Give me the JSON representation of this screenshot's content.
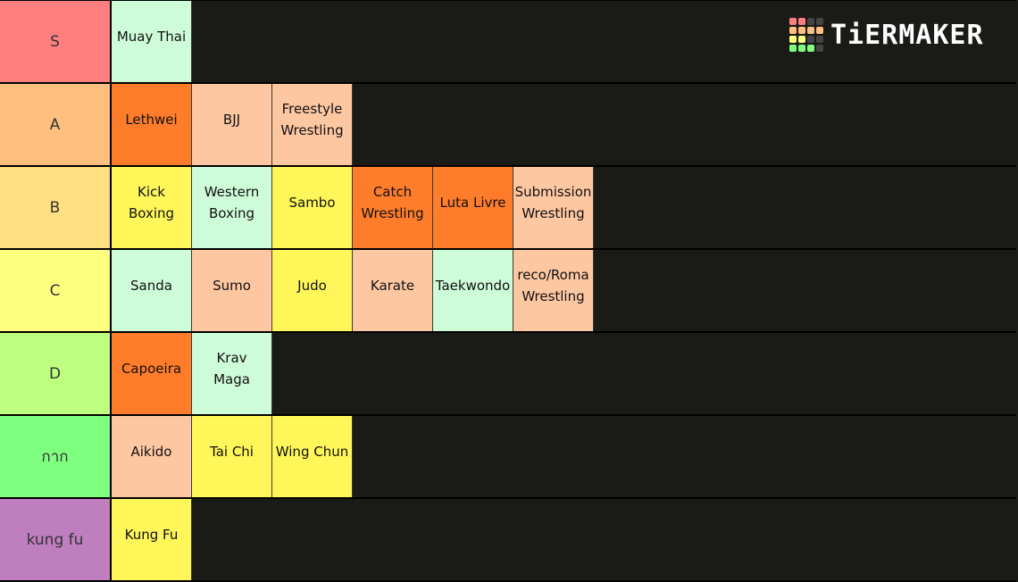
{
  "logo": {
    "text": "TiERMAKER",
    "grid_colors": [
      "#ff7f7f",
      "#ff7f7f",
      "#444444",
      "#444444",
      "#ffbf7f",
      "#ffbf7f",
      "#ffbf7f",
      "#ffbf7f",
      "#ffff7f",
      "#ffff7f",
      "#444444",
      "#444444",
      "#7fff7f",
      "#7fff7f",
      "#7fff7f",
      "#444444"
    ]
  },
  "tiers": [
    {
      "label": "S",
      "color": "#ff7f7f",
      "items": [
        {
          "name": "Muay Thai",
          "color": "#cffcd8"
        }
      ]
    },
    {
      "label": "A",
      "color": "#ffbf7f",
      "items": [
        {
          "name": "Lethwei",
          "color": "#fe7c2a"
        },
        {
          "name": "BJJ",
          "color": "#fdc7a2"
        },
        {
          "name": "Freestyle\nWrestling",
          "color": "#fdc7a2"
        }
      ]
    },
    {
      "label": "B",
      "color": "#ffdf7f",
      "items": [
        {
          "name": "Kick\nBoxing",
          "color": "#fff75a"
        },
        {
          "name": "Western\nBoxing",
          "color": "#cffcd8"
        },
        {
          "name": "Sambo",
          "color": "#fff75a"
        },
        {
          "name": "Catch\nWrestling",
          "color": "#fe7c2a"
        },
        {
          "name": "Luta Livre",
          "color": "#fe7c2a"
        },
        {
          "name": "Submission\nWrestling",
          "color": "#fdc7a2"
        }
      ]
    },
    {
      "label": "C",
      "color": "#ffff7f",
      "items": [
        {
          "name": "Sanda",
          "color": "#cffcd8"
        },
        {
          "name": "Sumo",
          "color": "#fdc7a2"
        },
        {
          "name": "Judo",
          "color": "#fff75a"
        },
        {
          "name": "Karate",
          "color": "#fdc7a2"
        },
        {
          "name": "Taekwondo",
          "color": "#cffcd8"
        },
        {
          "name": "reco/Roma\nWrestling",
          "color": "#fdc7a2"
        }
      ]
    },
    {
      "label": "D",
      "color": "#bfff7f",
      "items": [
        {
          "name": "Capoeira",
          "color": "#fe7c2a"
        },
        {
          "name": "Krav\nMaga",
          "color": "#cffcd8"
        }
      ]
    },
    {
      "label": "กาก",
      "color": "#7fff7f",
      "items": [
        {
          "name": "Aikido",
          "color": "#fdc7a2"
        },
        {
          "name": "Tai Chi",
          "color": "#fff75a"
        },
        {
          "name": "Wing Chun",
          "color": "#fff75a"
        }
      ]
    },
    {
      "label": "kung fu",
      "color": "#bf7fbf",
      "items": [
        {
          "name": "Kung Fu",
          "color": "#fff75a"
        }
      ]
    }
  ]
}
